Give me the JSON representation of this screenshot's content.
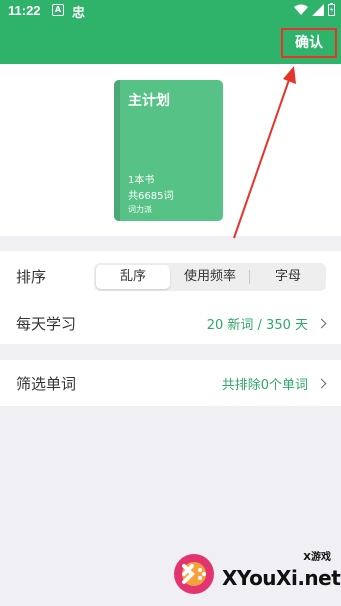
{
  "status_bar": {
    "time": "11:22",
    "icons": [
      "notification-a-icon",
      "app-icon",
      "wifi-icon",
      "signal-icon",
      "battery-icon"
    ]
  },
  "header": {
    "confirm_label": "确认",
    "accent_color": "#2fb36a",
    "highlight_color": "#e8332a"
  },
  "plan_card": {
    "title": "主计划",
    "book_count": "1本书",
    "word_count": "共6685词",
    "tag": "词力派"
  },
  "sort": {
    "label": "排序",
    "options": [
      "乱序",
      "使用频率",
      "字母"
    ],
    "selected": "乱序"
  },
  "daily": {
    "label": "每天学习",
    "value": "20 新词 / 350  天"
  },
  "filter": {
    "label": "筛选单词",
    "value": "共排除0个单词"
  },
  "watermark": {
    "top": "X游戏",
    "main": "XYouXi.net"
  }
}
